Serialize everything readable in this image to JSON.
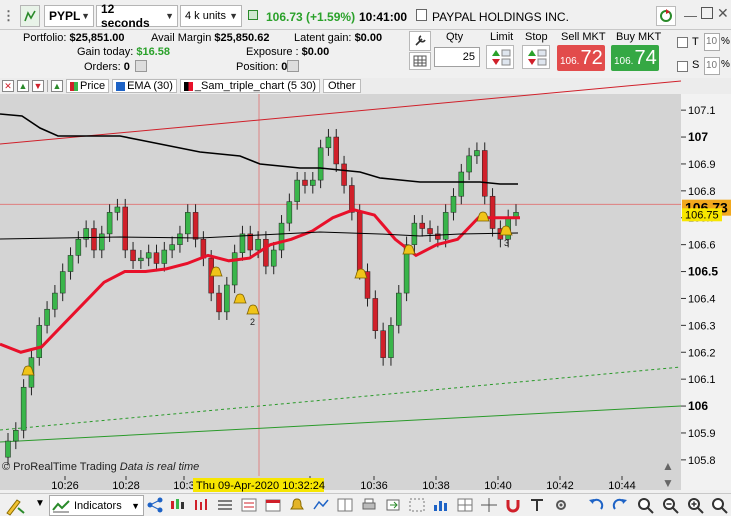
{
  "app": {
    "symbol": "PYPL",
    "interval": "12 seconds",
    "units": "4 k units",
    "price": "106.73",
    "change": "(+1.59%)",
    "time": "10:41:00",
    "company": "PAYPAL HOLDINGS INC."
  },
  "account": {
    "portfolio_label": "Portfolio:",
    "portfolio": "$25,851.00",
    "avail_label": "Avail Margin",
    "avail": "$25,850.62",
    "latent_label": "Latent gain:",
    "latent": "$0.00",
    "gain_label": "Gain today:",
    "gain": "$16.58",
    "exposure_label": "Exposure :",
    "exposure": "$0.00",
    "orders_label": "Orders:",
    "orders": "0",
    "position_label": "Position:",
    "position": "0"
  },
  "order": {
    "qty_label": "Qty",
    "qty": "25",
    "limit_label": "Limit",
    "stop_label": "Stop",
    "sell_label": "Sell MKT",
    "sell_small": "106.",
    "sell_big": "72",
    "buy_label": "Buy MKT",
    "buy_small": "106.",
    "buy_big": "74",
    "t_label": "T",
    "t_val": "10",
    "s_label": "S",
    "s_val": "10",
    "pct": "%"
  },
  "legend": {
    "price": "Price",
    "ema": "EMA (30)",
    "sam": "_Sam_triple_chart (5 30)",
    "other": "Other"
  },
  "axis": {
    "y_ticks": [
      "107.1",
      "107",
      "106.9",
      "106.8",
      "106.7",
      "106.6",
      "106.5",
      "106.4",
      "106.3",
      "106.2",
      "106.1",
      "106",
      "105.9",
      "105.8"
    ],
    "y_major": [
      "107",
      "106.5",
      "106"
    ],
    "x_ticks": [
      "10:26",
      "10:28",
      "10:3",
      "10:34",
      "10:36",
      "10:38",
      "10:40",
      "10:42",
      "10:44"
    ],
    "price_tag": "106.73",
    "cursor_price": "106.75",
    "cursor_time": "Thu 09-Apr-2020 10:32:24"
  },
  "chart_note": {
    "copyright": "© ProRealTime Trading",
    "realtime": "Data is real time"
  },
  "markers": [
    "2",
    "3"
  ],
  "bottom": {
    "indicators": "Indicators"
  },
  "colors": {
    "bull": "#39b54a",
    "bear": "#d0202a",
    "ema": "#e8102a",
    "plot_bg": "#d4d4d4",
    "price_tag": "#f2a81d",
    "cursor_tag": "#f7e600"
  },
  "chart_data": {
    "type": "candlestick",
    "x_range": [
      "10:25:12",
      "10:45:00"
    ],
    "ylim": [
      105.74,
      107.16
    ],
    "series": [
      {
        "name": "Price",
        "values": [
          105.87,
          105.91,
          106.07,
          106.18,
          106.3,
          106.36,
          106.42,
          106.5,
          106.56,
          106.62,
          106.66,
          106.58,
          106.64,
          106.72,
          106.74,
          106.58,
          106.54,
          106.55,
          106.57,
          106.53,
          106.58,
          106.6,
          106.64,
          106.72,
          106.62,
          106.55,
          106.42,
          106.35,
          106.45,
          106.57,
          106.64,
          106.58,
          106.62,
          106.52,
          106.58,
          106.68,
          106.76,
          106.84,
          106.82,
          106.84,
          106.96,
          107,
          106.9,
          106.82,
          106.72,
          106.5,
          106.4,
          106.28,
          106.18,
          106.3,
          106.42,
          106.6,
          106.68,
          106.66,
          106.64,
          106.62,
          106.72,
          106.78,
          106.87,
          106.93,
          106.95,
          106.78,
          106.66,
          106.62,
          106.7,
          106.72
        ]
      },
      {
        "name": "EMA (30)",
        "values": [
          106.23,
          106.2,
          106.22,
          106.3,
          106.38,
          106.46,
          106.5,
          106.5,
          106.51,
          106.53,
          106.56,
          106.54,
          106.55,
          106.6,
          106.62,
          106.65,
          106.7,
          106.73,
          106.71,
          106.62,
          106.56,
          106.6,
          106.62,
          106.7,
          106.7,
          106.7
        ]
      }
    ]
  }
}
